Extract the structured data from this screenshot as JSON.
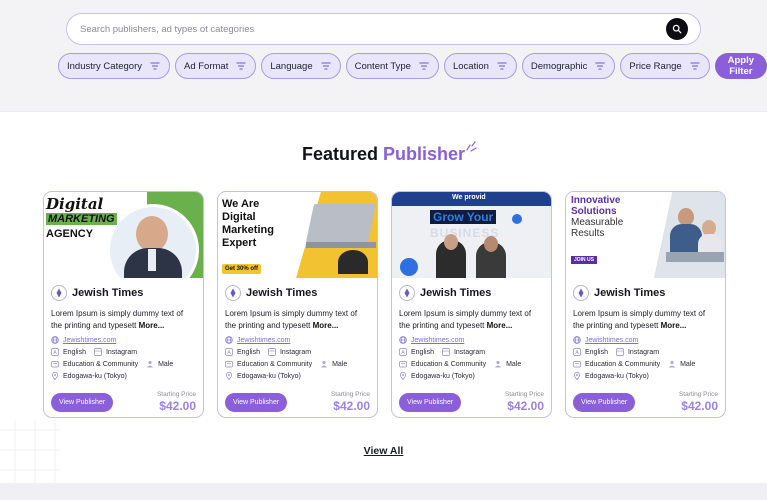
{
  "search": {
    "placeholder": "Search publishers, ad types ot categories"
  },
  "filters": [
    {
      "label": "Industry Category"
    },
    {
      "label": "Ad Format"
    },
    {
      "label": "Language"
    },
    {
      "label": "Content Type"
    },
    {
      "label": "Location"
    },
    {
      "label": "Demographic"
    },
    {
      "label": "Price Range"
    }
  ],
  "apply_label": "Apply Filter",
  "section": {
    "title_main": "Featured",
    "title_accent": "Publisher"
  },
  "cards": [
    {
      "banner": {
        "line1": "Digital",
        "line2": "MARKETING",
        "line3": "AGENCY"
      },
      "name": "Jewish Times",
      "desc": "Lorem Ipsum is simply dummy text of the printing and typesett",
      "more": "More...",
      "site": "Jewishtimes.com",
      "lang": "English",
      "platform": "Instagram",
      "category": "Education & Community",
      "gender": "Male",
      "location": "Edogawa-ku (Tokyo)",
      "button": "View Publisher",
      "price_label": "Starting Price",
      "price": "$42.00"
    },
    {
      "banner": {
        "line1": "We Are",
        "line2": "Digital",
        "line3": "Marketing",
        "line4": "Expert",
        "badge": "Get 30% off"
      },
      "name": "Jewish Times",
      "desc": "Lorem Ipsum is simply dummy text of the printing and typesett",
      "more": "More...",
      "site": "Jewishtimes.com",
      "lang": "English",
      "platform": "Instagram",
      "category": "Education & Community",
      "gender": "Male",
      "location": "Edogawa-ku (Tokyo)",
      "button": "View Publisher",
      "price_label": "Starting Price",
      "price": "$42.00"
    },
    {
      "banner": {
        "line1": "We provid",
        "line2": "Grow Your",
        "line3": "BUSINESS"
      },
      "name": "Jewish Times",
      "desc": "Lorem Ipsum is simply dummy text of the printing and typesett",
      "more": "More...",
      "site": "Jewishtimes.com",
      "lang": "English",
      "platform": "Instagram",
      "category": "Education & Community",
      "gender": "Male",
      "location": "Edogawa-ku (Tokyo)",
      "button": "View Publisher",
      "price_label": "Starting Price",
      "price": "$42.00"
    },
    {
      "banner": {
        "line1": "Innovative",
        "line2": "Solutions",
        "line3": "Measurable",
        "line4": "Results",
        "badge": "JOIN US"
      },
      "name": "Jewish Times",
      "desc": "Lorem Ipsum is simply dummy text of the printing and typesett",
      "more": "More...",
      "site": "Jewishtimes.com",
      "lang": "English",
      "platform": "Instagram",
      "category": "Education & Community",
      "gender": "Male",
      "location": "Edogawa-ku (Tokyo)",
      "button": "View Publisher",
      "price_label": "Starting Price",
      "price": "$42.00"
    }
  ],
  "view_all": "View All",
  "colors": {
    "accent": "#8a5fd9",
    "chip_bg": "#e9e6fb",
    "price": "#9a82e6"
  }
}
